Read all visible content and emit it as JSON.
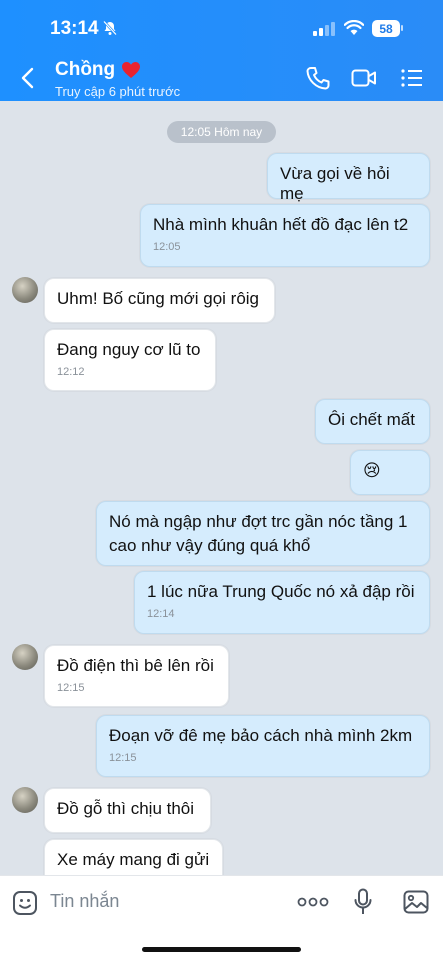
{
  "status_bar": {
    "time": "13:14",
    "battery": "58"
  },
  "header": {
    "name": "Chồng",
    "status": "Truy cập 6 phút trước"
  },
  "chat": {
    "date_label": "12:05 Hôm nay",
    "messages": [
      {
        "side": "out",
        "text": "Vừa gọi về hỏi mẹ",
        "time": ""
      },
      {
        "side": "out",
        "text": "Nhà mình khuân hết đồ đạc lên t2",
        "time": "12:05"
      },
      {
        "side": "in",
        "text": "Uhm! Bố cũng mới gọi rôig",
        "time": ""
      },
      {
        "side": "in",
        "text": "Đang nguy cơ lũ to",
        "time": "12:12"
      },
      {
        "side": "out",
        "text": "Ôi chết mất",
        "time": ""
      },
      {
        "side": "out",
        "text": "😢",
        "time": ""
      },
      {
        "side": "out",
        "text": "Nó mà ngập như đợt trc gần nóc tầng 1 cao như vậy đúng quá khổ",
        "time": ""
      },
      {
        "side": "out",
        "text": "1 lúc nữa Trung Quốc nó xả đập rồi",
        "time": "12:14"
      },
      {
        "side": "in",
        "text": "Đồ điện thì bê lên rồi",
        "time": "12:15"
      },
      {
        "side": "out",
        "text": "Đoạn vỡ đê mẹ bảo cách nhà mình 2km",
        "time": "12:15"
      },
      {
        "side": "in",
        "text": "Đồ gỗ thì chịu thôi",
        "time": ""
      },
      {
        "side": "in",
        "text": "Xe máy mang đi gửi",
        "time": ""
      }
    ]
  },
  "input": {
    "placeholder": "Tin nhắn"
  },
  "colors": {
    "header": "#1e90ff",
    "outgoing_bubble": "#d5ecfd",
    "incoming_bubble": "#ffffff",
    "background": "#dde3ea"
  }
}
